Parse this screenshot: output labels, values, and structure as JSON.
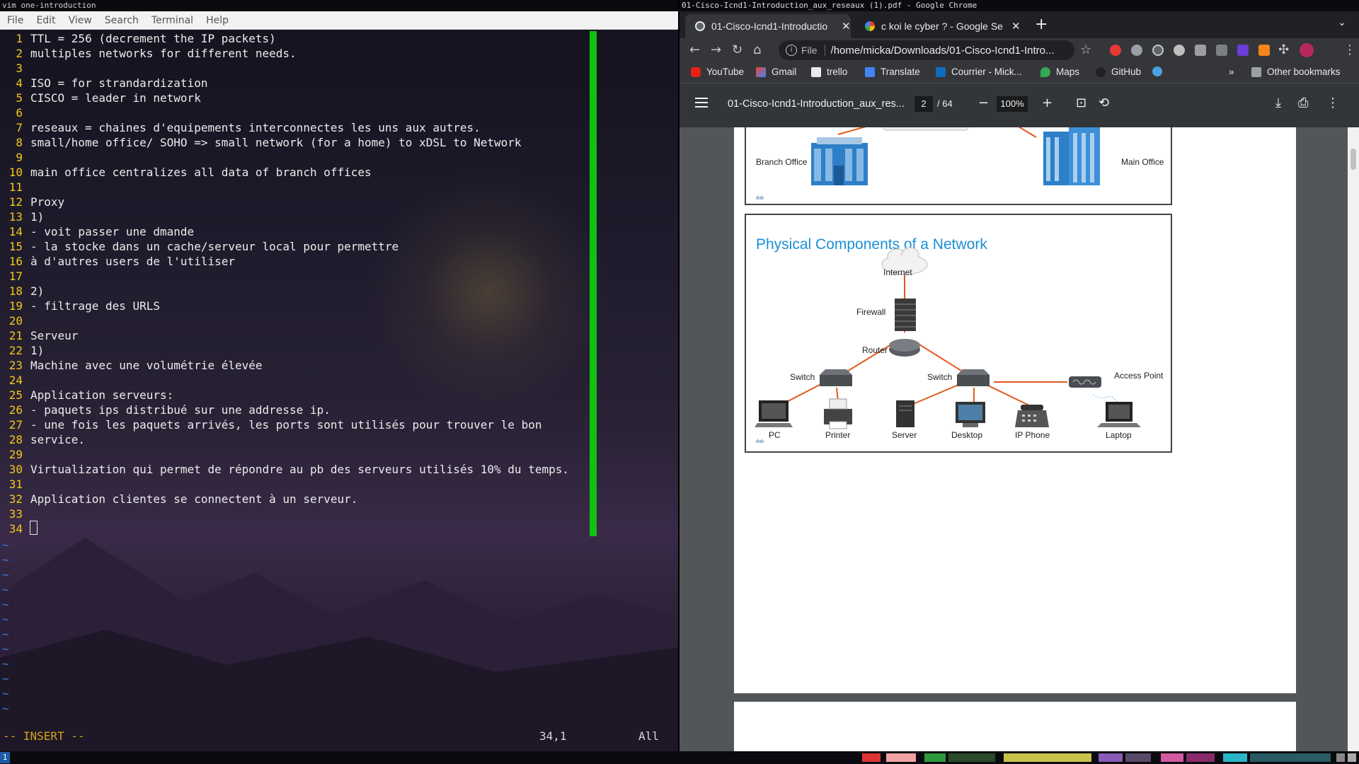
{
  "terminal": {
    "window_title": "vim one-introduction",
    "menu": [
      "File",
      "Edit",
      "View",
      "Search",
      "Terminal",
      "Help"
    ],
    "lines": [
      {
        "n": "1",
        "t": "TTL = 256 (decrement the IP packets)"
      },
      {
        "n": "2",
        "t": "multiples networks for different needs."
      },
      {
        "n": "3",
        "t": ""
      },
      {
        "n": "4",
        "t": "ISO = for strandardization"
      },
      {
        "n": "5",
        "t": "CISCO = leader in network"
      },
      {
        "n": "6",
        "t": ""
      },
      {
        "n": "7",
        "t": "reseaux = chaines d'equipements interconnectes les uns aux autres."
      },
      {
        "n": "8",
        "t": "small/home office/ SOHO => small network (for a home) to xDSL to Network"
      },
      {
        "n": "9",
        "t": ""
      },
      {
        "n": "10",
        "t": "main office centralizes all data of branch offices"
      },
      {
        "n": "11",
        "t": ""
      },
      {
        "n": "12",
        "t": "Proxy"
      },
      {
        "n": "13",
        "t": "1)"
      },
      {
        "n": "14",
        "t": "- voit passer une dmande"
      },
      {
        "n": "15",
        "t": "- la stocke dans un cache/serveur local pour permettre"
      },
      {
        "n": "16",
        "t": "à d'autres users de l'utiliser"
      },
      {
        "n": "17",
        "t": ""
      },
      {
        "n": "18",
        "t": "2)"
      },
      {
        "n": "19",
        "t": "- filtrage des URLS"
      },
      {
        "n": "20",
        "t": ""
      },
      {
        "n": "21",
        "t": "Serveur"
      },
      {
        "n": "22",
        "t": "1)"
      },
      {
        "n": "23",
        "t": "Machine avec une volumétrie élevée"
      },
      {
        "n": "24",
        "t": ""
      },
      {
        "n": "25",
        "t": "Application serveurs:"
      },
      {
        "n": "26",
        "t": "- paquets ips distribué sur une addresse ip."
      },
      {
        "n": "27",
        "t": "- une fois les paquets arrivés, les ports sont utilisés pour trouver le bon"
      },
      {
        "n": "28",
        "t": "service."
      },
      {
        "n": "29",
        "t": ""
      },
      {
        "n": "30",
        "t": "Virtualization qui permet de répondre au pb des serveurs utilisés 10% du temps."
      },
      {
        "n": "31",
        "t": ""
      },
      {
        "n": "32",
        "t": "Application clientes se connectent à un serveur."
      },
      {
        "n": "33",
        "t": ""
      },
      {
        "n": "34",
        "t": ""
      }
    ],
    "tilde": "~",
    "status": {
      "mode": "-- INSERT --",
      "position": "34,1",
      "scroll": "All"
    },
    "colors": {
      "line_numbers": "#f2c81a",
      "marker_bar": "#11c011",
      "tilde": "#3b78e0"
    }
  },
  "chrome": {
    "window_title": "01-Cisco-Icnd1-Introduction_aux_reseaux (1).pdf - Google Chrome",
    "tabs": [
      {
        "title": "01-Cisco-Icnd1-Introductio",
        "active": true
      },
      {
        "title": "c koi le cyber ? - Google Se",
        "active": false
      }
    ],
    "omnibox": {
      "scheme": "File",
      "url": "/home/micka/Downloads/01-Cisco-Icnd1-Intro..."
    },
    "bookmarks": [
      "YouTube",
      "Gmail",
      "trello",
      "Translate",
      "Courrier - Mick...",
      "Maps",
      "GitHub"
    ],
    "other_bookmarks": "Other bookmarks",
    "more": "»",
    "pdf": {
      "file_name": "01-Cisco-Icnd1-Introduction_aux_res...",
      "page": "2",
      "page_total": "/ 64",
      "zoom": "100%",
      "slide_top_labels": {
        "branch": "Branch Office",
        "main": "Main Office"
      },
      "slide": {
        "title": "Physical Components of a Network",
        "labels": {
          "internet": "Internet",
          "firewall": "Firewall",
          "router": "Router",
          "switch_left": "Switch",
          "switch_right": "Switch",
          "access_point": "Access Point",
          "pc": "PC",
          "printer": "Printer",
          "server": "Server",
          "desktop": "Desktop",
          "ip_phone": "IP Phone",
          "laptop": "Laptop"
        }
      }
    }
  },
  "taskbar": {
    "workspace": "1"
  }
}
